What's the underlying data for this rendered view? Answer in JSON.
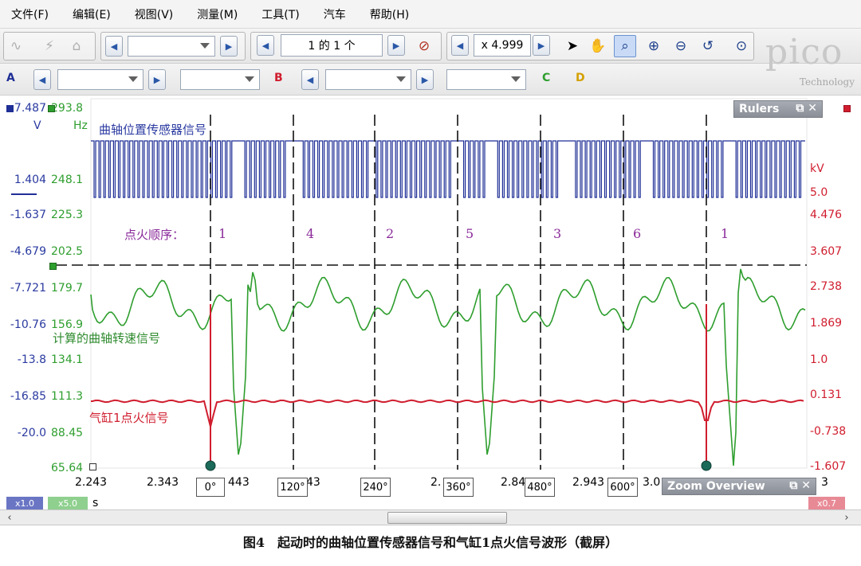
{
  "menu": [
    "文件(F)",
    "编辑(E)",
    "视图(V)",
    "测量(M)",
    "工具(T)",
    "汽车",
    "帮助(H)"
  ],
  "toolbar": {
    "page_indicator": "1 的 1 个",
    "zoom_value": "x 4.999",
    "channel_labels": [
      "A",
      "B",
      "C",
      "D"
    ]
  },
  "brand": {
    "logo": "pico",
    "subtitle": "Technology"
  },
  "scope": {
    "unit_a": "V",
    "unit_b": "Hz",
    "unit_c": "kV",
    "axis_a": [
      "7.487",
      "1.404",
      "-1.637",
      "-4.679",
      "-7.721",
      "-10.76",
      "-13.8",
      "-16.85",
      "-20.0"
    ],
    "axis_b": [
      "293.8",
      "248.1",
      "225.3",
      "202.5",
      "179.7",
      "156.9",
      "134.1",
      "111.3",
      "88.45",
      "65.64"
    ],
    "axis_c": [
      "5.0",
      "4.476",
      "3.607",
      "2.738",
      "1.869",
      "1.0",
      "0.131",
      "-0.738",
      "-1.607"
    ],
    "time_ticks": [
      "2.243",
      "2.343",
      "443",
      "43",
      "2.",
      "2.84",
      "2.943",
      "3.0",
      "3"
    ],
    "time_unit": "s",
    "angles": [
      "0°",
      "120°",
      "240°",
      "360°",
      "480°",
      "600°"
    ],
    "firing_order_label": "点火顺序：",
    "firing_order": [
      "1",
      "4",
      "2",
      "5",
      "3",
      "6",
      "1"
    ],
    "labels": {
      "crank_sensor": "曲轴位置传感器信号",
      "calc_speed": "计算的曲轴转速信号",
      "cyl1_ignition": "气缸1点火信号"
    },
    "rulers_title": "Rulers",
    "zoom_overview_title": "Zoom Overview",
    "zoom_a": "x1.0",
    "zoom_b": "x5.0",
    "zoom_c": "x0.7",
    "colors": {
      "channel_a": "#1f2f96",
      "channel_b": "#2e9e2e",
      "channel_c": "#d01d2e"
    }
  },
  "caption": "图4　起动时的曲轴位置传感器信号和气缸1点火信号波形（截屏）"
}
